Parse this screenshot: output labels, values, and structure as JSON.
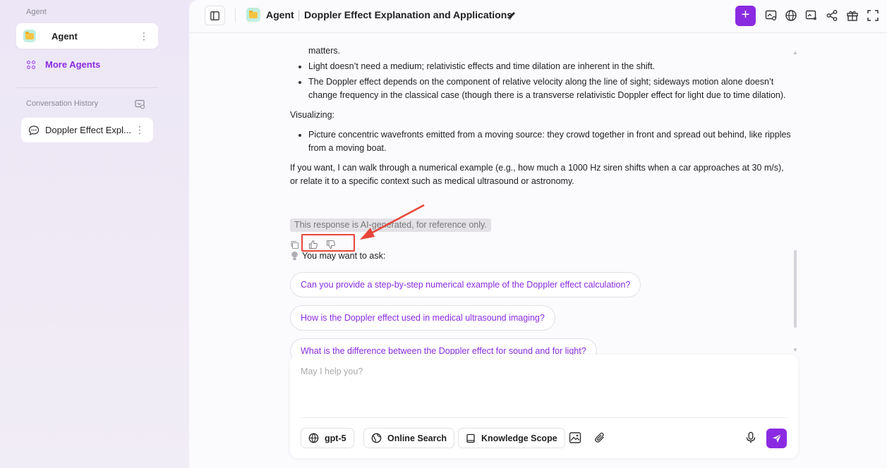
{
  "sidebar": {
    "section_label": "Agent",
    "agent_name": "Agent",
    "more_agents": "More Agents",
    "history_label": "Conversation History",
    "history_items": [
      "Doppler Effect Expl..."
    ]
  },
  "header": {
    "agent": "Agent",
    "title": "Doppler Effect Explanation and Applications",
    "new_label": "+"
  },
  "content": {
    "line_top": "matters.",
    "bullets_a": [
      "Light doesn’t need a medium; relativistic effects and time dilation are inherent in the shift.",
      "The Doppler effect depends on the component of relative velocity along the line of sight; sideways motion alone doesn’t change frequency in the classical case (though there is a transverse relativistic Doppler effect for light due to time dilation)."
    ],
    "visualizing": "Visualizing:",
    "bullets_b": [
      "Picture concentric wavefronts emitted from a moving source: they crowd together in front and spread out behind, like ripples from a moving boat."
    ],
    "closing": "If you want, I can walk through a numerical example (e.g., how much a 1000 Hz siren shifts when a car approaches at 30 m/s), or relate it to a specific context such as medical ultrasound or astronomy.",
    "disclaimer": "This response is AI-generated, for reference only.",
    "ask_label": "You may want to ask:",
    "suggestions": [
      "Can you provide a step-by-step numerical example of the Doppler effect calculation?",
      "How is the Doppler effect used in medical ultrasound imaging?",
      "What is the difference between the Doppler effect for sound and for light?"
    ]
  },
  "composer": {
    "placeholder": "May I help you?",
    "model": "gpt-5",
    "online_search": "Online Search",
    "knowledge_scope": "Knowledge Scope"
  },
  "colors": {
    "accent": "#8a2be2",
    "highlight": "#e8463a"
  }
}
